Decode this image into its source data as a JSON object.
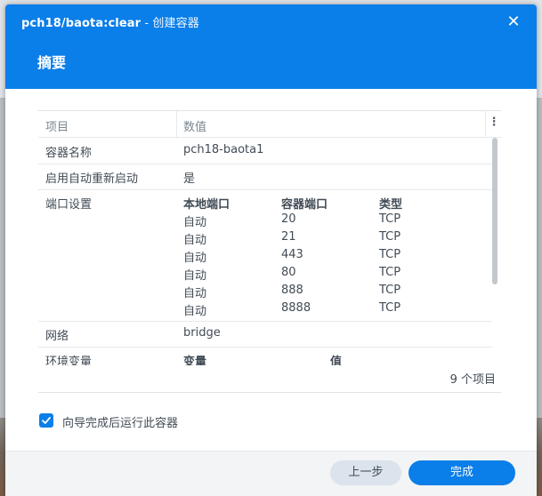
{
  "window": {
    "title": "pch18/baota:clear",
    "subtitle": " - 创建容器",
    "close_glyph": "✕"
  },
  "section_title": "摘要",
  "table": {
    "columns": [
      "项目",
      "数值"
    ],
    "menu_glyph": "⋮",
    "rows": {
      "name": {
        "key": "容器名称",
        "value": "pch18-baota1"
      },
      "autorestart": {
        "key": "启用自动重新启动",
        "value": "是"
      },
      "ports": {
        "key": "端口设置",
        "headers": [
          "本地端口",
          "容器端口",
          "类型"
        ],
        "items": [
          [
            "自动",
            "20",
            "TCP"
          ],
          [
            "自动",
            "21",
            "TCP"
          ],
          [
            "自动",
            "443",
            "TCP"
          ],
          [
            "自动",
            "80",
            "TCP"
          ],
          [
            "自动",
            "888",
            "TCP"
          ],
          [
            "自动",
            "8888",
            "TCP"
          ]
        ]
      },
      "network": {
        "key": "网络",
        "value": "bridge"
      },
      "env": {
        "key": "环境变量",
        "headers": [
          "变量",
          "值"
        ]
      }
    },
    "count_label": "9 个项目"
  },
  "run_after_wizard": {
    "checked": true,
    "label": "向导完成后运行此容器"
  },
  "buttons": {
    "prev": "上一步",
    "done": "完成"
  },
  "colors": {
    "accent": "#0a7ee9",
    "text": "#414b55",
    "muted": "#7c8791"
  }
}
